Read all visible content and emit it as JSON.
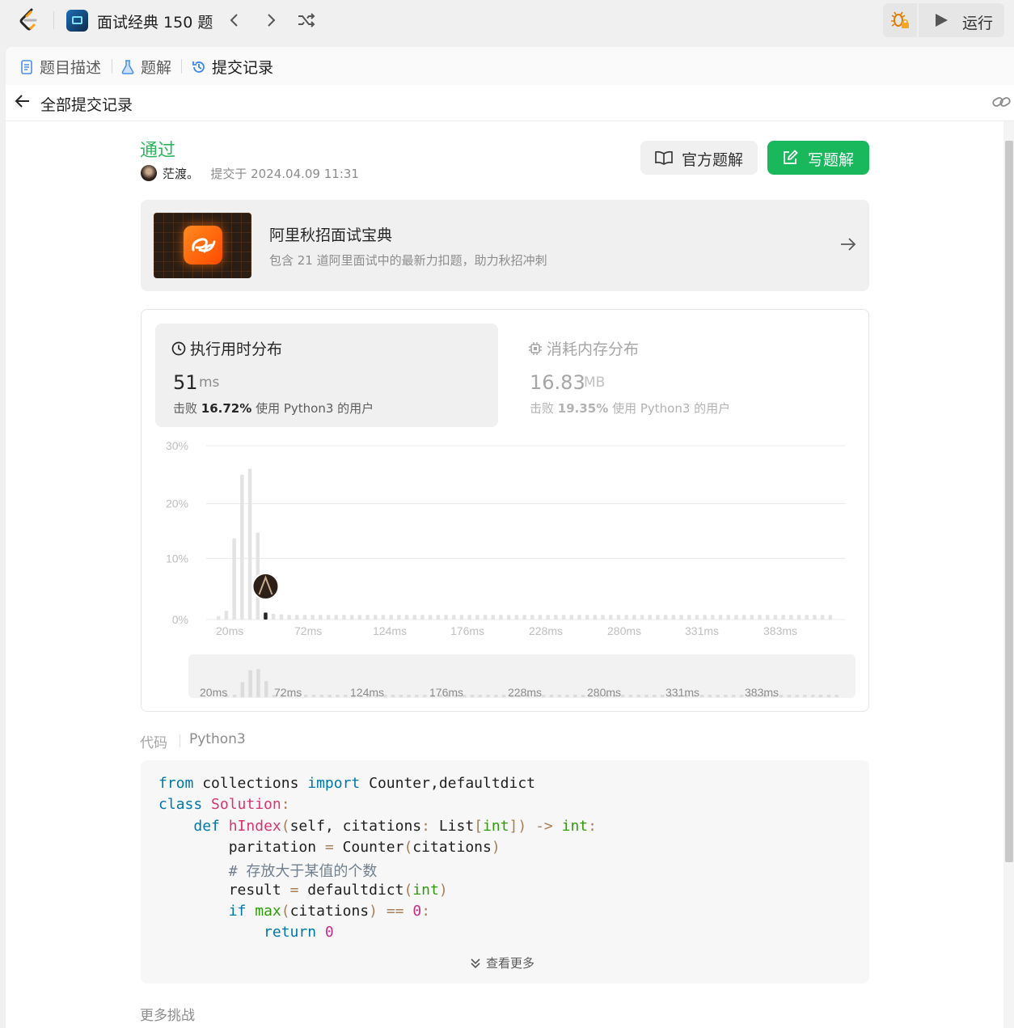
{
  "topbar": {
    "problem_set_title": "面试经典 150 题",
    "run_label": "运行"
  },
  "tabs": [
    {
      "label": "题目描述",
      "icon": "document-icon"
    },
    {
      "label": "题解",
      "icon": "flask-icon"
    },
    {
      "label": "提交记录",
      "icon": "history-icon",
      "active": true
    }
  ],
  "subheader": {
    "back_label": "全部提交记录"
  },
  "submission": {
    "status": "通过",
    "user": "茫渡。",
    "submitted_text": "提交于 2024.04.09 11:31",
    "official_solution_label": "官方题解",
    "write_solution_label": "写题解"
  },
  "banner": {
    "title": "阿里秋招面试宝典",
    "subtitle": "包含 21 道阿里面试中的最新力扣题，助力秋招冲刺"
  },
  "runtime": {
    "title": "执行用时分布",
    "value": "51",
    "unit": "ms",
    "beat_prefix": "击败",
    "beat_percent": "16.72%",
    "beat_suffix": "使用 Python3 的用户"
  },
  "memory": {
    "title": "消耗内存分布",
    "value": "16.83",
    "unit": "MB",
    "beat_prefix": "击败",
    "beat_percent": "19.35%",
    "beat_suffix": "使用 Python3 的用户"
  },
  "chart_data": {
    "type": "bar",
    "xlabel": "",
    "ylabel": "",
    "ylim": [
      0,
      30
    ],
    "y_ticks": [
      "30%",
      "20%",
      "10%",
      "0%"
    ],
    "x_tick_labels": [
      "20ms",
      "72ms",
      "124ms",
      "176ms",
      "228ms",
      "280ms",
      "331ms",
      "383ms"
    ],
    "highlight_index": 6,
    "highlight_color": "#262626",
    "bar_color": "#e3e3e3",
    "values": [
      0.6,
      1.5,
      14,
      25,
      26,
      15,
      1.2,
      1.0,
      0.9,
      0.8,
      0.8,
      0.8,
      0.8,
      0.8,
      0.8,
      0.8,
      0.8,
      0.8,
      0.8,
      0.8,
      0.8,
      0.8,
      0.8,
      0.8,
      0.8,
      0.8,
      0.8,
      0.8,
      0.8,
      0.8,
      0.8,
      0.8,
      0.8,
      0.8,
      0.8,
      0.8,
      0.8,
      0.8,
      0.8,
      0.8,
      0.8,
      0.8,
      0.8,
      0.8,
      0.8,
      0.8,
      0.8,
      0.8,
      0.8,
      0.8,
      0.8,
      0.8,
      0.8,
      0.8,
      0.8,
      0.8,
      0.8,
      0.8,
      0.8,
      0.8,
      0.8,
      0.8,
      0.8,
      0.8,
      0.8,
      0.8,
      0.8,
      0.8,
      0.8,
      0.8,
      0.8,
      0.8,
      0.8,
      0.8,
      0.8,
      0.8,
      0.8,
      0.8,
      0.8
    ]
  },
  "code_section": {
    "label": "代码",
    "language": "Python3",
    "lines": [
      "from collections import Counter,defaultdict",
      "class Solution:",
      "    def hIndex(self, citations: List[int]) -> int:",
      "        paritation = Counter(citations)",
      "        # 存放大于某值的个数",
      "        result = defaultdict(int)",
      "        if max(citations) == 0:",
      "            return 0"
    ],
    "more_label": "查看更多"
  },
  "more_challenges_label": "更多挑战"
}
